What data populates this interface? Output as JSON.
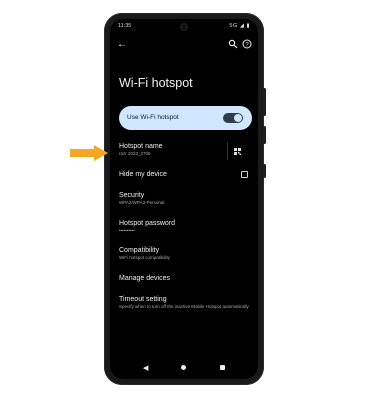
{
  "status": {
    "time": "11:35",
    "icons": "5G ◢ ▮"
  },
  "appbar": {
    "back_icon": "arrow-left-icon",
    "search_icon": "search-icon",
    "help_icon": "help-icon"
  },
  "title": "Wi-Fi hotspot",
  "toggle": {
    "label": "Use Wi-Fi hotspot",
    "state": "on"
  },
  "settings": [
    {
      "title": "Hotspot name",
      "subtitle": "razr 2023_2706"
    },
    {
      "title": "Hide my device",
      "subtitle": ""
    },
    {
      "title": "Security",
      "subtitle": "WPA2/WPA3-Personal"
    },
    {
      "title": "Hotspot password",
      "subtitle": "••••••••••"
    },
    {
      "title": "Compatibility",
      "subtitle": "WiFi hotspot compatibility"
    },
    {
      "title": "Manage devices",
      "subtitle": ""
    },
    {
      "title": "Timeout setting",
      "subtitle": "Specify when to turn off the inactive Mobile Hotspot automatically"
    }
  ],
  "callout_color": "#f5a623"
}
